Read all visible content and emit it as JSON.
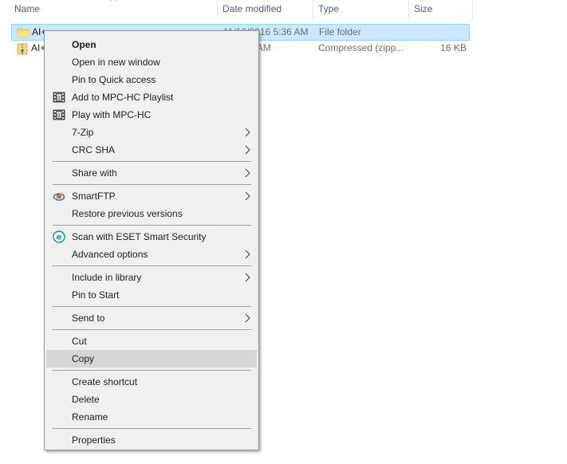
{
  "file_list": {
    "columns": {
      "name": "Name",
      "date_modified": "Date modified",
      "type": "Type",
      "size": "Size"
    },
    "rows": [
      {
        "name": "AI+",
        "date_modified": "11/16/2016 5:36 AM",
        "type": "File folder",
        "size": "",
        "icon": "folder-icon",
        "selected": true
      },
      {
        "name": "AI+",
        "date_modified": "16 5:28 AM",
        "type": "Compressed (zipp...",
        "size": "16 KB",
        "icon": "zip-folder-icon",
        "selected": false
      }
    ]
  },
  "context_menu": {
    "items": {
      "open": "Open",
      "open_new_window": "Open in new window",
      "pin_quick_access": "Pin to Quick access",
      "add_mpc_playlist": "Add to MPC-HC Playlist",
      "play_mpc": "Play with MPC-HC",
      "seven_zip": "7-Zip",
      "crc_sha": "CRC SHA",
      "share_with": "Share with",
      "smartftp": "SmartFTP",
      "restore_versions": "Restore previous versions",
      "scan_eset": "Scan with ESET Smart Security",
      "advanced_options": "Advanced options",
      "include_library": "Include in library",
      "pin_start": "Pin to Start",
      "send_to": "Send to",
      "cut": "Cut",
      "copy": "Copy",
      "create_shortcut": "Create shortcut",
      "delete": "Delete",
      "rename": "Rename",
      "properties": "Properties"
    },
    "highlighted_item": "Copy"
  },
  "colors": {
    "selection_fill": "#cce8ff",
    "selection_border": "#99d1ff",
    "menu_background": "#f0f0f0",
    "menu_highlight": "#d6d6d6",
    "header_text": "#4c607a",
    "eset_accent": "#0096a5"
  }
}
